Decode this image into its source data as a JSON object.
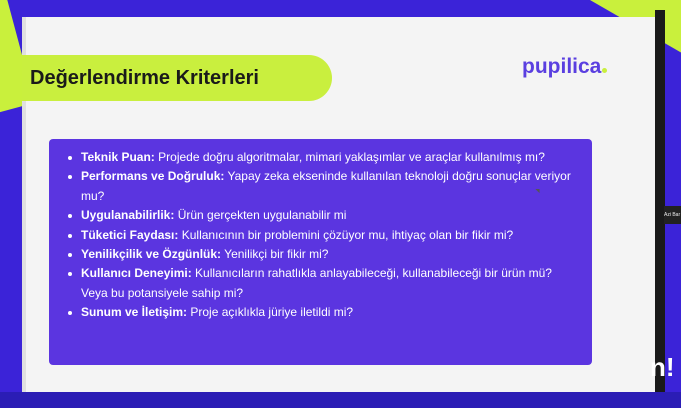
{
  "slide": {
    "title": "Değerlendirme Kriterleri",
    "logo_text": "pupilica",
    "criteria": [
      {
        "name": "Teknik Puan:",
        "text": "Projede doğru algoritmalar, mimari yaklaşımlar ve araçlar kullanılmış mı?"
      },
      {
        "name": "Performans ve Doğruluk:",
        "text": "Yapay zeka ekseninde kullanılan teknoloji doğru sonuçlar veriyor mu?"
      },
      {
        "name": "Uygulanabilirlik:",
        "text": "Ürün gerçekten uygulanabilir mi"
      },
      {
        "name": "Tüketici Faydası:",
        "text": "Kullanıcının bir problemini çözüyor mu, ihtiyaç olan bir fikir mi?"
      },
      {
        "name": "Yenilikçilik ve Özgünlük:",
        "text": "Yenilikçi bir fikir mi?"
      },
      {
        "name": "Kullanıcı Deneyimi:",
        "text": "Kullanıcıların rahatlıkla anlayabileceği, kullanabileceği bir ürün mü? Veya bu potansiyele sahip mi?"
      },
      {
        "name": "Sunum ve İletişim:",
        "text": "Proje açıklıkla jüriye iletildi mi?"
      }
    ]
  },
  "overlay": {
    "side_tag": "Azi Bar",
    "corner_text": "n!"
  },
  "colors": {
    "background": "#3b23d8",
    "lime": "#c9ef3e",
    "box": "#5b35e0",
    "logo": "#5a3fe0"
  }
}
